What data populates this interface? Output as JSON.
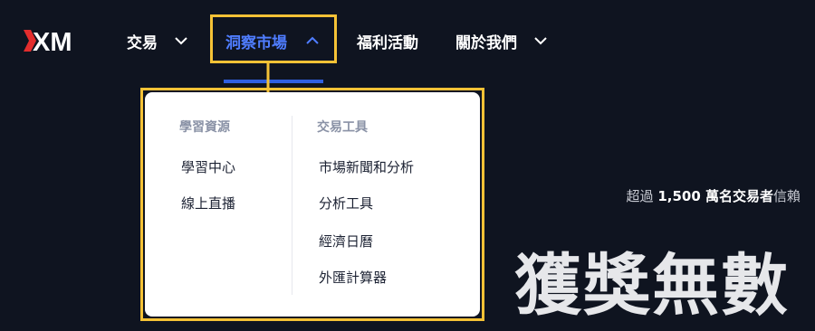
{
  "brand": {
    "logo_text": "XM",
    "accent": "#e32d2d"
  },
  "nav": {
    "items": [
      {
        "label": "交易",
        "has_dropdown": true,
        "active": false
      },
      {
        "label": "洞察市場",
        "has_dropdown": true,
        "active": true
      },
      {
        "label": "福利活動",
        "has_dropdown": false,
        "active": false
      },
      {
        "label": "關於我們",
        "has_dropdown": true,
        "active": false
      }
    ],
    "active_color": "#4f7dff",
    "highlight_color": "#f5c236"
  },
  "dropdown": {
    "columns": [
      {
        "title": "學習資源",
        "links": [
          "學習中心",
          "線上直播"
        ]
      },
      {
        "title": "交易工具",
        "links": [
          "市場新聞和分析",
          "分析工具",
          "經濟日曆",
          "外匯計算器"
        ]
      }
    ]
  },
  "hero": {
    "trust_prefix": "超過",
    "trust_highlight": "1,500 萬名交易者",
    "trust_suffix": "信賴",
    "title": "獲獎無數"
  }
}
